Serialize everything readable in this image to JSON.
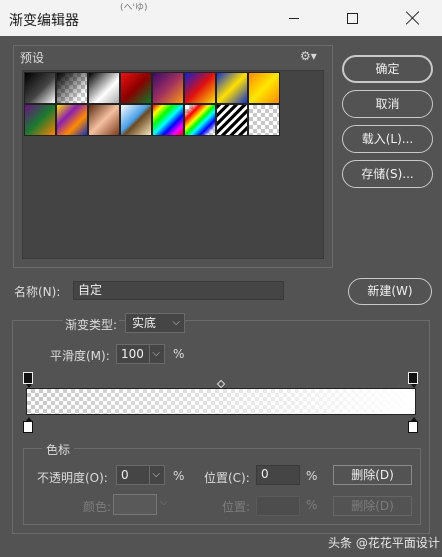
{
  "window": {
    "title": "渐变编辑器",
    "fragment": "(ヘ'ゆ)",
    "minimize_icon": "minimize-icon",
    "maximize_icon": "maximize-icon",
    "close_icon": "close-icon"
  },
  "presets": {
    "legend": "预设",
    "gear_glyph": "⚙▾",
    "swatches": [
      {
        "name": "black-to-white"
      },
      {
        "name": "black-to-transparent"
      },
      {
        "name": "black-to-white-metallic"
      },
      {
        "name": "red-to-green"
      },
      {
        "name": "violet-to-orange"
      },
      {
        "name": "blue-red-yellow"
      },
      {
        "name": "blue-yellow-blue"
      },
      {
        "name": "orange-yellow-orange"
      },
      {
        "name": "violet-green-orange"
      },
      {
        "name": "yellow-violet-orange-blue"
      },
      {
        "name": "copper"
      },
      {
        "name": "chrome"
      },
      {
        "name": "spectrum"
      },
      {
        "name": "transparent-rainbow"
      },
      {
        "name": "transparent-stripes"
      },
      {
        "name": "neutral-density"
      }
    ]
  },
  "buttons": {
    "ok": "确定",
    "cancel": "取消",
    "load": "载入(L)...",
    "save": "存储(S)...",
    "new": "新建(W)",
    "delete_opacity": "删除(D)",
    "delete_color": "删除(D)"
  },
  "name_field": {
    "label": "名称(N):",
    "value": "自定"
  },
  "gradient": {
    "type_label": "渐变类型:",
    "type_value": "实底",
    "smoothness_label": "平滑度(M):",
    "smoothness_value": "100",
    "smoothness_unit": "%"
  },
  "stops": {
    "legend": "色标",
    "opacity_label": "不透明度(O):",
    "opacity_value": "0",
    "opacity_unit": "%",
    "opacity_location_label": "位置(C):",
    "opacity_location_value": "0",
    "opacity_location_unit": "%",
    "color_label": "颜色:",
    "color_location_label": "位置:",
    "color_location_value": "",
    "color_location_unit": "%"
  },
  "watermark": "头条 @花花平面设计"
}
